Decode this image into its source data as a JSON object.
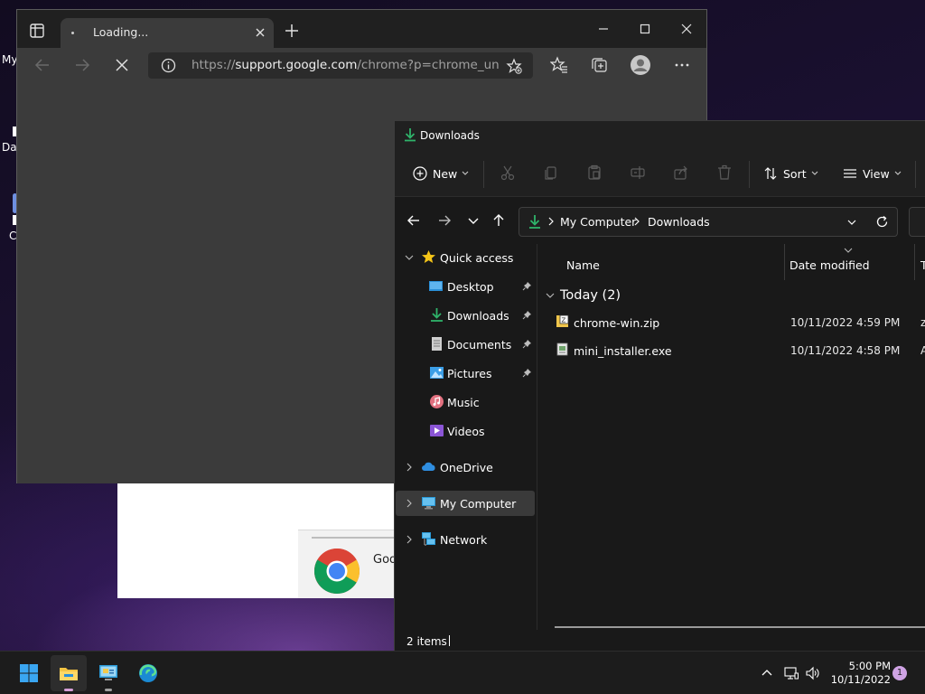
{
  "desktop": {
    "fragments": [
      "My",
      "Da",
      "C"
    ]
  },
  "installer": {
    "partial_text": "Goo"
  },
  "browser": {
    "tab_title": "Loading...",
    "url_prefix": "https://",
    "url_host": "support.google.com",
    "url_path": "/chrome?p=chrome_unin..."
  },
  "explorer": {
    "window_title": "Downloads",
    "commands": {
      "new": "New",
      "sort": "Sort",
      "view": "View"
    },
    "breadcrumb": [
      "My Computer",
      "Downloads"
    ],
    "sidebar": [
      {
        "label": "Quick access",
        "icon": "star-icon"
      },
      {
        "label": "Desktop",
        "icon": "desktop-icon"
      },
      {
        "label": "Downloads",
        "icon": "download-icon"
      },
      {
        "label": "Documents",
        "icon": "documents-icon"
      },
      {
        "label": "Pictures",
        "icon": "pictures-icon"
      },
      {
        "label": "Music",
        "icon": "music-icon"
      },
      {
        "label": "Videos",
        "icon": "videos-icon"
      },
      {
        "label": "OneDrive",
        "icon": "cloud-icon"
      },
      {
        "label": "My Computer",
        "icon": "computer-icon"
      },
      {
        "label": "Network",
        "icon": "network-icon"
      }
    ],
    "columns": {
      "name": "Name",
      "date_modified": "Date modified",
      "type": "T"
    },
    "group": "Today (2)",
    "files": [
      {
        "name": "chrome-win.zip",
        "date": "10/11/2022 4:59 PM",
        "type": "z",
        "icon": "zip-icon"
      },
      {
        "name": "mini_installer.exe",
        "date": "10/11/2022 4:58 PM",
        "type": "A",
        "icon": "exe-icon"
      }
    ],
    "status": "2 items"
  },
  "taskbar": {
    "time": "5:00 PM",
    "date": "10/11/2022",
    "notifications": "1"
  },
  "colors": {
    "accent_green": "#2fb36a",
    "explorer_bg": "#191919",
    "browser_bg": "#3b3b3b"
  }
}
